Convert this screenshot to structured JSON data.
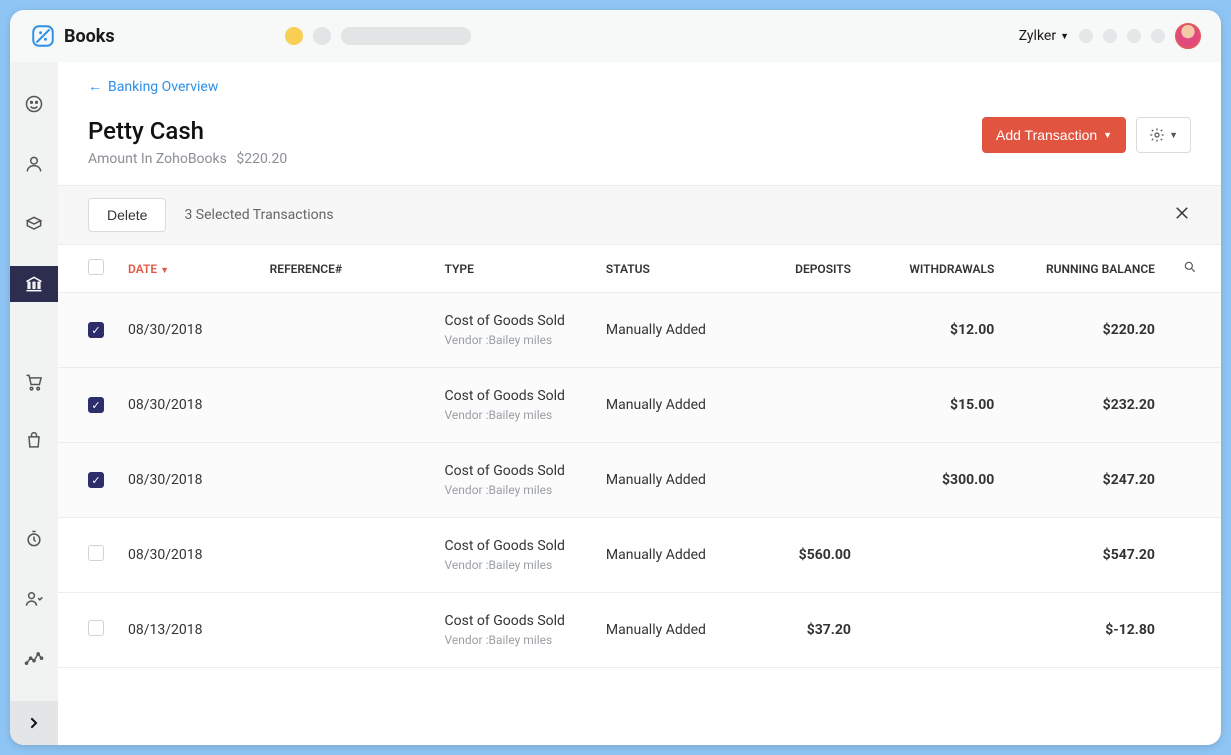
{
  "brand": {
    "name": "Books"
  },
  "header": {
    "org_name": "Zylker"
  },
  "page": {
    "back_label": "Banking Overview",
    "title": "Petty Cash",
    "balance_label": "Amount In ZohoBooks",
    "balance_value": "$220.20",
    "add_button": "Add Transaction"
  },
  "toolbar": {
    "delete_label": "Delete",
    "selection_text": "3 Selected Transactions"
  },
  "columns": {
    "date": "DATE",
    "reference": "REFERENCE#",
    "type": "TYPE",
    "status": "STATUS",
    "deposits": "DEPOSITS",
    "withdrawals": "WITHDRAWALS",
    "running_balance": "RUNNING BALANCE"
  },
  "rows": [
    {
      "checked": true,
      "date": "08/30/2018",
      "type": "Cost of Goods Sold",
      "vendor": "Vendor :Bailey miles",
      "status": "Manually Added",
      "deposit": "",
      "withdrawal": "$12.00",
      "balance": "$220.20"
    },
    {
      "checked": true,
      "date": "08/30/2018",
      "type": "Cost of Goods Sold",
      "vendor": "Vendor :Bailey miles",
      "status": "Manually Added",
      "deposit": "",
      "withdrawal": "$15.00",
      "balance": "$232.20"
    },
    {
      "checked": true,
      "date": "08/30/2018",
      "type": "Cost of Goods Sold",
      "vendor": "Vendor :Bailey miles",
      "status": "Manually Added",
      "deposit": "",
      "withdrawal": "$300.00",
      "balance": "$247.20"
    },
    {
      "checked": false,
      "date": "08/30/2018",
      "type": "Cost of Goods Sold",
      "vendor": "Vendor :Bailey miles",
      "status": "Manually Added",
      "deposit": "$560.00",
      "withdrawal": "",
      "balance": "$547.20"
    },
    {
      "checked": false,
      "date": "08/13/2018",
      "type": "Cost of Goods Sold",
      "vendor": "Vendor :Bailey miles",
      "status": "Manually Added",
      "deposit": "$37.20",
      "withdrawal": "",
      "balance": "$-12.80"
    }
  ]
}
